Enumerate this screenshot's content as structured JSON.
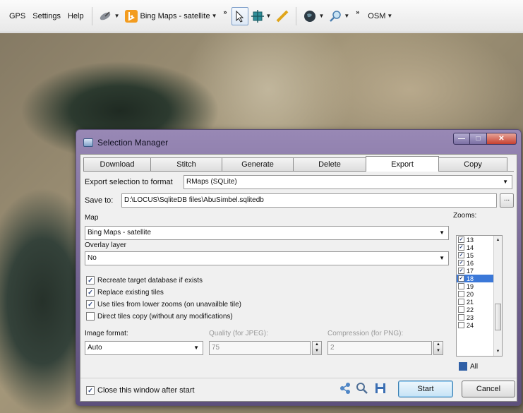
{
  "toolbar": {
    "menus": [
      "GPS",
      "Settings",
      "Help"
    ],
    "map_source": "Bing Maps - satellite",
    "overlay_source": "OSM",
    "icons": [
      "satellite-dish-icon",
      "bing-logo-icon",
      "pointer-icon",
      "move-icon",
      "ruler-icon",
      "globe-icon",
      "search-icon"
    ]
  },
  "window": {
    "title": "Selection Manager",
    "tabs": [
      "Download",
      "Stitch",
      "Generate",
      "Delete",
      "Export",
      "Copy"
    ],
    "active_tab": "Export"
  },
  "export": {
    "format_label": "Export selection to format",
    "format_value": "RMaps (SQLite)",
    "save_to_label": "Save to:",
    "save_to_value": "D:\\LOCUS\\SqliteDB files\\AbuSimbel.sqlitedb",
    "browse_label": "...",
    "map_label": "Map",
    "map_value": "Bing Maps - satellite",
    "overlay_label": "Overlay layer",
    "overlay_value": "No",
    "options": [
      {
        "label": "Recreate target database if exists",
        "checked": true
      },
      {
        "label": "Replace existing tiles",
        "checked": true
      },
      {
        "label": "Use tiles from lower zooms (on unavailble tile)",
        "checked": true
      },
      {
        "label": "Direct tiles copy (without any modifications)",
        "checked": false
      }
    ],
    "image_format_label": "Image format:",
    "image_format_value": "Auto",
    "quality_label": "Quality (for JPEG):",
    "quality_value": "75",
    "compression_label": "Compression (for PNG):",
    "compression_value": "2",
    "zooms_label": "Zooms:",
    "zooms": [
      {
        "level": "13",
        "checked": true
      },
      {
        "level": "14",
        "checked": true
      },
      {
        "level": "15",
        "checked": true
      },
      {
        "level": "16",
        "checked": true
      },
      {
        "level": "17",
        "checked": true
      },
      {
        "level": "18",
        "checked": true,
        "selected": true
      },
      {
        "level": "19",
        "checked": false
      },
      {
        "level": "20",
        "checked": false
      },
      {
        "level": "21",
        "checked": false
      },
      {
        "level": "22",
        "checked": false
      },
      {
        "level": "23",
        "checked": false
      },
      {
        "level": "24",
        "checked": false
      }
    ],
    "all_label": "All"
  },
  "footer": {
    "close_after_start_label": "Close this window after start",
    "close_after_start_checked": true,
    "start_label": "Start",
    "cancel_label": "Cancel"
  }
}
